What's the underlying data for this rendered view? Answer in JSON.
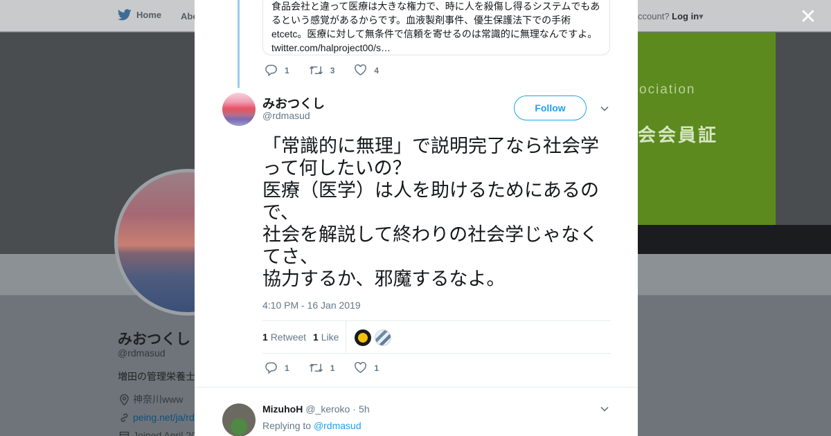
{
  "background": {
    "nav": {
      "home": "Home",
      "about": "Abo",
      "account_prefix": "ccount?",
      "login": "Log in"
    },
    "banner": {
      "line1": "ociation",
      "line2": "会会員証"
    },
    "profile": {
      "name": "みおつくし",
      "handle": "@rdmasud",
      "bio": "増田の管理栄養士",
      "location": "神奈川www",
      "url": "peing.net/ja/rd",
      "joined": "Joined April 20"
    }
  },
  "modal": {
    "quoted_tweet": {
      "lines": [
        "食品会社と違って医療は大きな権力で、時に人を殺傷し得るシステムでもあ",
        "るという感覚があるからです。血液製剤事件、優生保護法下での手術",
        "etcetc。医療に対して無条件で信頼を寄せるのは常識的に無理なんですよ。",
        "twitter.com/halproject00/s…"
      ]
    },
    "parent_actions": {
      "replies": "1",
      "retweets": "3",
      "likes": "4"
    },
    "main_tweet": {
      "author_name": "みおつくし",
      "author_handle": "@rdmasud",
      "follow_label": "Follow",
      "text_lines": [
        "「常識的に無理」で説明完了なら社会学",
        "って何したいの？",
        "医療（医学）は人を助けるためにあるの",
        "で、",
        "社会を解説して終わりの社会学じゃなく",
        "てさ、",
        "協力するか、邪魔するなよ。"
      ],
      "timestamp": "4:10 PM - 16 Jan 2019",
      "retweet_count": "1",
      "retweet_label": "Retweet",
      "like_count": "1",
      "like_label": "Like",
      "actions": {
        "replies": "1",
        "retweets": "1",
        "likes": "1"
      }
    },
    "reply": {
      "name": "MizuhoH",
      "handle": "@_keroko",
      "separator": "·",
      "time": "5h",
      "replying_prefix": "Replying to",
      "replying_to": "@rdmasud"
    }
  },
  "colors": {
    "accent": "#1da1f2",
    "thread_line": "#9bcbf2",
    "muted": "#657786"
  }
}
